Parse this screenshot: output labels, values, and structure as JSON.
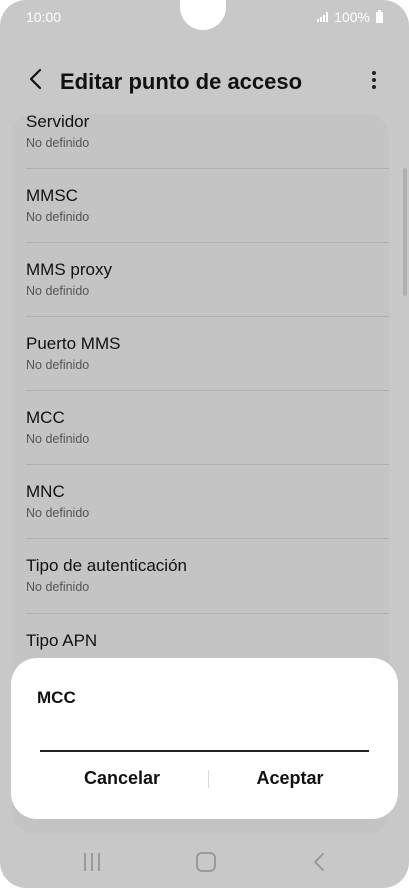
{
  "status_bar": {
    "time": "10:00",
    "battery": "100%"
  },
  "header": {
    "title": "Editar punto de acceso"
  },
  "list": {
    "items": [
      {
        "title": "Servidor",
        "value": "No definido"
      },
      {
        "title": "MMSC",
        "value": "No definido"
      },
      {
        "title": "MMS proxy",
        "value": "No definido"
      },
      {
        "title": "Puerto MMS",
        "value": "No definido"
      },
      {
        "title": "MCC",
        "value": "No definido"
      },
      {
        "title": "MNC",
        "value": "No definido"
      },
      {
        "title": "Tipo de autenticación",
        "value": "No definido"
      },
      {
        "title": "Tipo APN",
        "value": ""
      }
    ]
  },
  "dialog": {
    "title": "MCC",
    "input_value": "",
    "cancel_label": "Cancelar",
    "accept_label": "Aceptar"
  },
  "icons": {
    "back": "chevron-left-icon",
    "more": "more-vertical-icon",
    "nav_recents": "recents-icon",
    "nav_home": "home-icon",
    "nav_back": "back-icon"
  }
}
